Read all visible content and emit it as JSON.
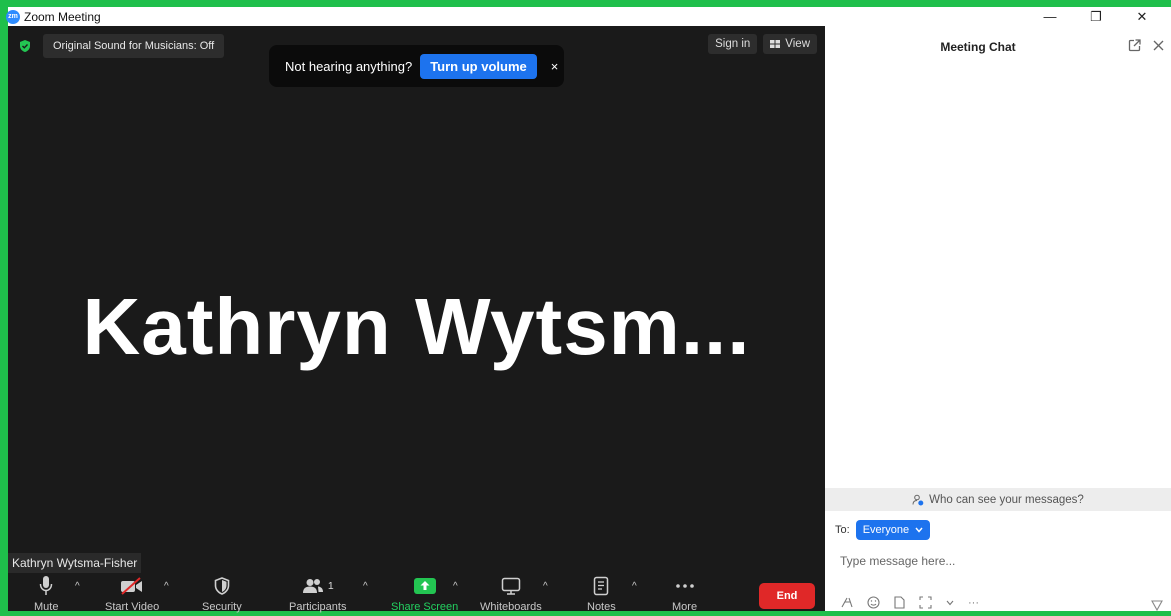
{
  "window": {
    "title": "Zoom Meeting",
    "logo_text": "zm",
    "controls": {
      "minimize": "—",
      "restore": "❐",
      "close": "✕"
    }
  },
  "video": {
    "sound_badge": "Original Sound for Musicians: Off",
    "toast": {
      "text": "Not hearing anything?",
      "button": "Turn up volume",
      "close": "×"
    },
    "sign_in": "Sign in",
    "view": "View",
    "participant_big_name": "Kathryn Wytsm...",
    "participant_tag": "Kathryn Wytsma-Fisher"
  },
  "toolbar": {
    "mute": "Mute",
    "start_video": "Start Video",
    "security": "Security",
    "participants": "Participants",
    "participants_count": "1",
    "share_screen": "Share Screen",
    "whiteboards": "Whiteboards",
    "notes": "Notes",
    "more": "More",
    "end": "End",
    "caret": "^"
  },
  "chat": {
    "title": "Meeting Chat",
    "who_can_see": "Who can see your messages?",
    "to_label": "To:",
    "recipient": "Everyone",
    "message_placeholder": "Type message here...",
    "more_tools": "···"
  },
  "colors": {
    "frame_border": "#1fbf4b",
    "video_bg": "#1a1a1a",
    "accent_blue": "#1d73ee",
    "end_red": "#e02828",
    "share_green": "#23d160"
  }
}
